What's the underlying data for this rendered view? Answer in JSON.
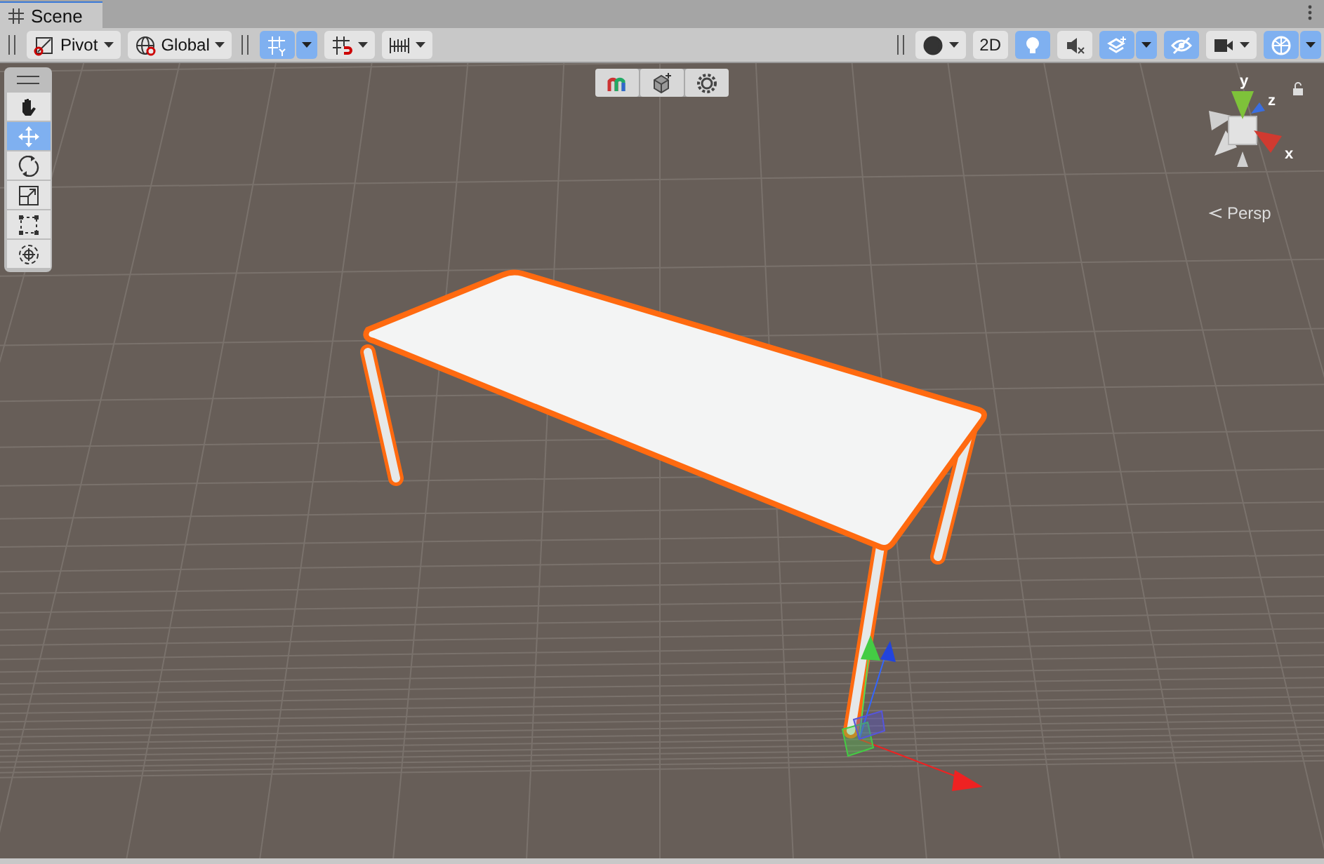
{
  "tab": {
    "title": "Scene",
    "selected": true
  },
  "toolbar_left": [
    {
      "kind": "pivot",
      "label": "Pivot",
      "selected": false,
      "dropdown": true
    },
    {
      "kind": "global",
      "label": "Global",
      "selected": false,
      "dropdown": true
    },
    {
      "kind": "separator"
    },
    {
      "kind": "grid-snap",
      "selected": true,
      "dropdown": true
    },
    {
      "kind": "increment-snap",
      "selected": false,
      "dropdown": true
    },
    {
      "kind": "ruler",
      "selected": false,
      "dropdown": true
    }
  ],
  "toolbar_right": [
    {
      "kind": "shading",
      "selected": false,
      "dropdown": true
    },
    {
      "kind": "text",
      "label": "2D",
      "selected": false,
      "dropdown": false
    },
    {
      "kind": "lighting",
      "selected": true,
      "dropdown": false
    },
    {
      "kind": "audio",
      "selected": false,
      "dropdown": false
    },
    {
      "kind": "effects",
      "selected": true,
      "dropdown": true
    },
    {
      "kind": "visibility",
      "selected": true,
      "dropdown": false
    },
    {
      "kind": "camera",
      "selected": false,
      "dropdown": true
    },
    {
      "kind": "gizmos",
      "selected": true,
      "dropdown": true
    }
  ],
  "tools": [
    {
      "kind": "hand",
      "selected": false
    },
    {
      "kind": "move",
      "selected": true
    },
    {
      "kind": "rotate",
      "selected": false
    },
    {
      "kind": "scale",
      "selected": false
    },
    {
      "kind": "rect",
      "selected": false
    },
    {
      "kind": "transform",
      "selected": false
    }
  ],
  "overlay_buttons": [
    {
      "kind": "colors"
    },
    {
      "kind": "add-object"
    },
    {
      "kind": "settings"
    }
  ],
  "orientation_gizmo": {
    "axes": [
      {
        "kind": "y",
        "label": "y"
      },
      {
        "kind": "z",
        "label": "z"
      },
      {
        "kind": "x",
        "label": "x"
      }
    ],
    "projection": "Persp"
  }
}
